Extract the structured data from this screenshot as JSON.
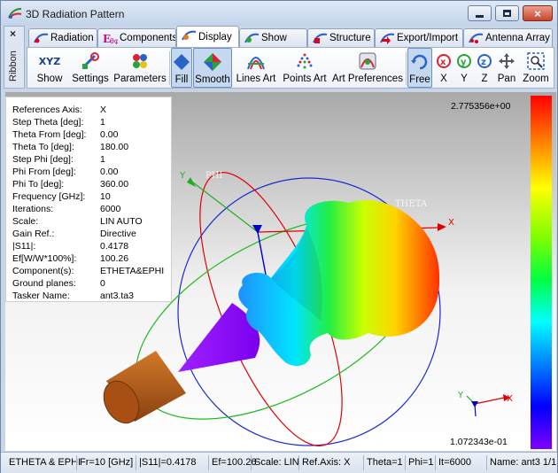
{
  "window": {
    "title": "3D Radiation Pattern",
    "buttons": {
      "minimize": "minimize",
      "maximize": "maximize",
      "close": "×"
    }
  },
  "ribbon": {
    "close": "×",
    "label": "Ribbon"
  },
  "tabs": [
    {
      "label": "Radiation",
      "icon": "radiation-icon"
    },
    {
      "label": "Components",
      "icon": "components-icon"
    },
    {
      "label": "Display",
      "icon": "display-icon"
    },
    {
      "label": "Show",
      "icon": "show-icon"
    },
    {
      "label": "Structure",
      "icon": "structure-icon"
    },
    {
      "label": "Export/Import",
      "icon": "export-import-icon"
    },
    {
      "label": "Antenna Array",
      "icon": "antenna-array-icon"
    }
  ],
  "toolbar": {
    "show_icon_text": "XYZ",
    "show": "Show",
    "settings": "Settings",
    "parameters": "Parameters",
    "fill": "Fill",
    "smooth": "Smooth",
    "lines_art": "Lines Art",
    "points_art": "Points Art",
    "art_preferences": "Art Preferences",
    "free": "Free",
    "x": "X",
    "y": "Y",
    "z": "Z",
    "pan": "Pan",
    "zoom": "Zoom"
  },
  "info": [
    {
      "key": "References Axis:",
      "value": "X"
    },
    {
      "key": "Step Theta [deg]:",
      "value": "1"
    },
    {
      "key": "Theta From [deg]:",
      "value": "0.00"
    },
    {
      "key": "Theta To [deg]:",
      "value": "180.00"
    },
    {
      "key": "Step Phi [deg]:",
      "value": "1"
    },
    {
      "key": "Phi From [deg]:",
      "value": "0.00"
    },
    {
      "key": "Phi To [deg]:",
      "value": "360.00"
    },
    {
      "key": "Frequency [GHz]:",
      "value": "10"
    },
    {
      "key": "Iterations:",
      "value": "6000"
    },
    {
      "key": "Scale:",
      "value": "LIN AUTO"
    },
    {
      "key": "Gain Ref.:",
      "value": "Directive"
    },
    {
      "key": "|S11|:",
      "value": "0.4178"
    },
    {
      "key": "Ef[W/W*100%]:",
      "value": "100.26"
    },
    {
      "key": "Component(s):",
      "value": "ETHETA&EPHI"
    },
    {
      "key": "Ground planes:",
      "value": "0"
    },
    {
      "key": "Tasker Name:",
      "value": "ant3.ta3"
    }
  ],
  "scene": {
    "axis_y": "Y",
    "axis_x": "X",
    "phi_label": "PHI",
    "theta_label": "THETA",
    "mini_y": "Y",
    "mini_x": "X"
  },
  "scale": {
    "max": "2.775356e+00",
    "min": "1.072343e-01"
  },
  "status": {
    "components": "ETHETA & EPHI",
    "frequency": "Fr=10 [GHz]",
    "s11": "|S11|=0.4178",
    "efficiency": "Ef=100.26",
    "scale": "Scale: LIN",
    "ref_axis": "Ref.Axis: X",
    "theta": "Theta=1",
    "phi": "Phi=1",
    "iterations": "It=6000",
    "name": "Name: ant3 1/1"
  },
  "colors": {
    "window_frame": "#c9d6e8",
    "pressed": "#c4d8ef",
    "axis_x": "#e00000",
    "axis_y": "#00a000",
    "axis_z": "#0000cc",
    "cone": "#8a00ff",
    "feed": "#b35a13"
  }
}
